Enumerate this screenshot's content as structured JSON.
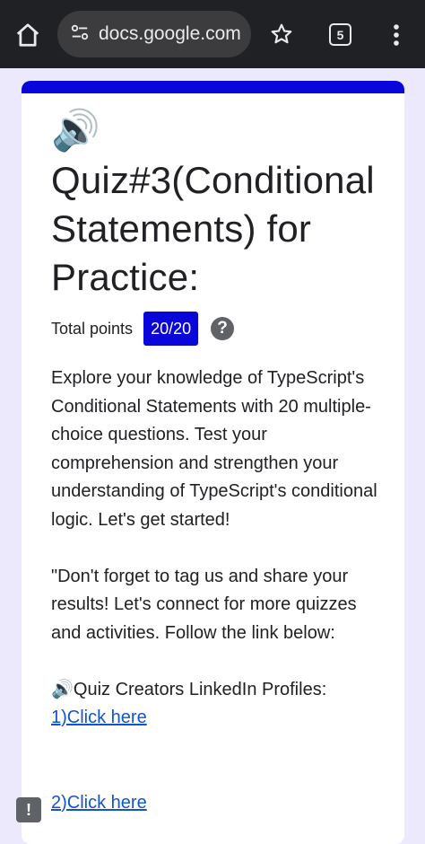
{
  "browser": {
    "url": "docs.google.com",
    "tab_count": "5"
  },
  "form": {
    "header_emoji": "🔊",
    "title": "Quiz#3(Conditional Statements) for Practice:",
    "points_label": "Total points",
    "points_value": "20/20",
    "help_glyph": "?",
    "description": {
      "line1": "Explore your knowledge of TypeScript's Conditional Statements with 20 multiple-choice questions. Test your comprehension and strengthen your understanding of TypeScript's conditional logic. Let's get started!",
      "line2": "\"Don't forget to tag us and share your results! Let's connect for more quizzes and activities. Follow the link below:",
      "line3": "🔊Quiz Creators LinkedIn Profiles:",
      "link1": "1)Click here",
      "link2": "2)Click here"
    }
  },
  "feedback_glyph": "!",
  "colors": {
    "accent": "#0a05d8",
    "page_bg": "#ebe9fb",
    "toolbar_bg": "#202124"
  }
}
